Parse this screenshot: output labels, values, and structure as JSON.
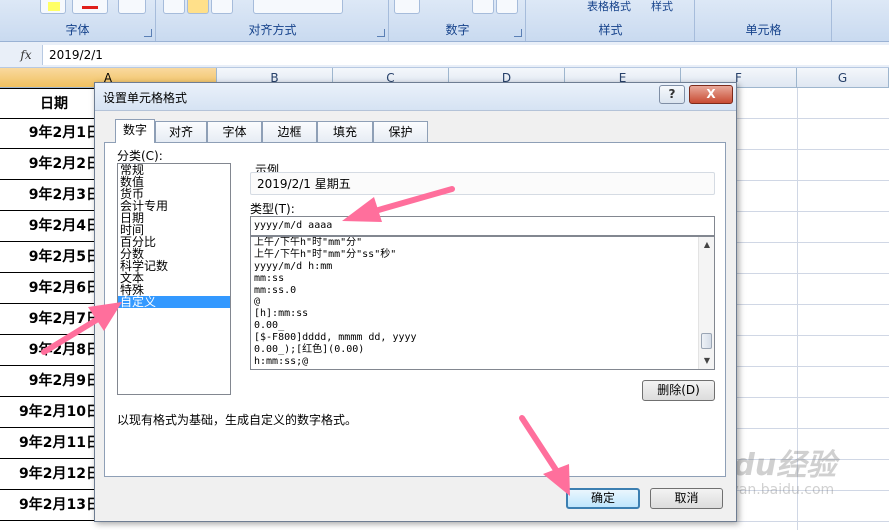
{
  "ribbon": {
    "groups": [
      {
        "label": "字体"
      },
      {
        "label": "对齐方式"
      },
      {
        "label": "数字"
      },
      {
        "label": "样式"
      },
      {
        "label": "单元格"
      }
    ],
    "style_buttons": {
      "table_format": "表格格式",
      "cell_style": "样式"
    }
  },
  "formula_bar": {
    "fx_icon": "fx-icon",
    "value": "2019/2/1"
  },
  "sheet": {
    "columns": [
      "A",
      "B",
      "C",
      "D",
      "E",
      "F",
      "G"
    ],
    "header_cell": "日期",
    "rows": [
      "9年2月1日",
      "9年2月2日",
      "9年2月3日",
      "9年2月4日",
      "9年2月5日",
      "9年2月6日",
      "9年2月7日",
      "9年2月8日",
      "9年2月9日",
      "9年2月10日",
      "9年2月11日",
      "9年2月12日",
      "9年2月13日"
    ]
  },
  "dialog": {
    "title": "设置单元格格式",
    "help_label": "?",
    "close_label": "X",
    "tabs": [
      "数字",
      "对齐",
      "字体",
      "边框",
      "填充",
      "保护"
    ],
    "active_tab": "数字",
    "category_label": "分类(C):",
    "categories": [
      "常规",
      "数值",
      "货币",
      "会计专用",
      "日期",
      "时间",
      "百分比",
      "分数",
      "科学记数",
      "文本",
      "特殊",
      "自定义"
    ],
    "selected_category": "自定义",
    "sample_label": "示例",
    "sample_value": "2019/2/1 星期五",
    "type_label": "类型(T):",
    "type_value": "yyyy/m/d aaaa",
    "formats": [
      "上午/下午h\"时\"mm\"分\"",
      "上午/下午h\"时\"mm\"分\"ss\"秒\"",
      "yyyy/m/d h:mm",
      "mm:ss",
      "mm:ss.0",
      "@",
      "[h]:mm:ss",
      "0.00_",
      "[$-F800]dddd, mmmm dd, yyyy",
      "0.00_);[红色](0.00)",
      "h:mm:ss;@"
    ],
    "delete_label": "删除(D)",
    "description": "以现有格式为基础，生成自定义的数字格式。",
    "ok_label": "确定",
    "cancel_label": "取消"
  },
  "watermark": {
    "text": "Baidu经验",
    "sub": "jingyan.baidu.com"
  },
  "colors": {
    "accent_arrow": "#ff6f9c",
    "selection": "#3399ff"
  }
}
